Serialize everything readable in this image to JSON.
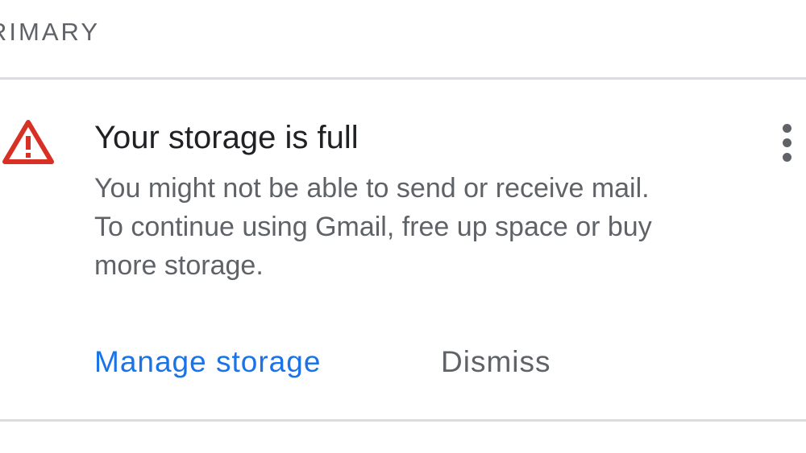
{
  "section": {
    "label": "RIMARY"
  },
  "notice": {
    "icon": "warning-triangle-icon",
    "icon_color": "#d93025",
    "title": "Your storage is full",
    "body_lines": [
      "You might not be able to send or receive mail.",
      "To continue using Gmail, free up space or buy",
      "more storage."
    ],
    "more_icon": "more-vert-icon",
    "actions": {
      "primary_label": "Manage storage",
      "secondary_label": "Dismiss"
    }
  },
  "colors": {
    "primary_action": "#1a73e8",
    "secondary_text": "#5f6368",
    "title_text": "#202124",
    "divider": "#dadce0"
  }
}
